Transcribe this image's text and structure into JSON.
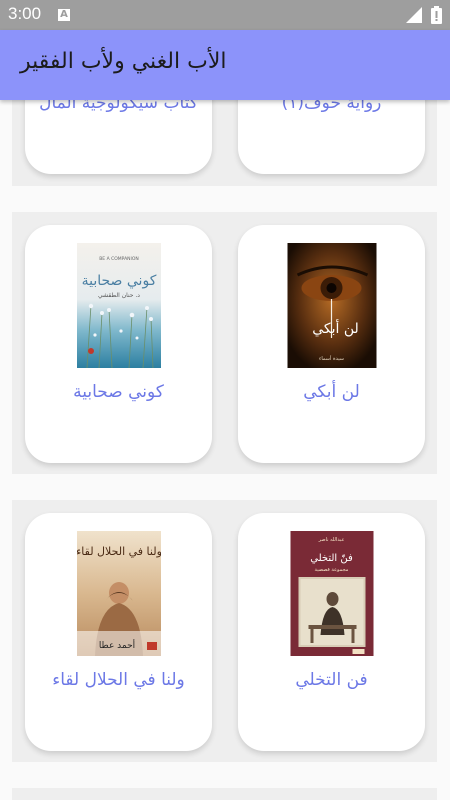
{
  "status_bar": {
    "time": "3:00",
    "notification_icon": "A",
    "icons": [
      "notification-a-icon",
      "signal-icon",
      "battery-icon"
    ]
  },
  "app_bar": {
    "title": "الأب الغني ولأب الفقير"
  },
  "books": [
    {
      "title": "كتاب سيكولوجية المال",
      "cover": "partial"
    },
    {
      "title": "رواية خوف(١)",
      "cover": "partial"
    },
    {
      "title": "كوني صحابية",
      "cover_text": "كوني صحابية",
      "cover_tagline": "BE A COMPANION",
      "cover_author": "د. حنان الطقشي"
    },
    {
      "title": "لن أبكي",
      "cover_text": "لن أبكي",
      "cover_author": "سيدة أسماء"
    },
    {
      "title": "ولنا في الحلال لقاء",
      "cover_text": "ولنا في الحلال لقاء",
      "cover_author": "أحمد عطا"
    },
    {
      "title": "فن التخلي",
      "cover_text": "فنّ التخلي",
      "cover_author": "عبدالله ناصر",
      "cover_sub": "مجموعة قصصية"
    }
  ],
  "colors": {
    "status_bar": "#9e9e9e",
    "app_bar": "#8c93fa",
    "title_text": "#6c78e6",
    "row_bg": "#eeeeee",
    "card_bg": "#ffffff"
  }
}
